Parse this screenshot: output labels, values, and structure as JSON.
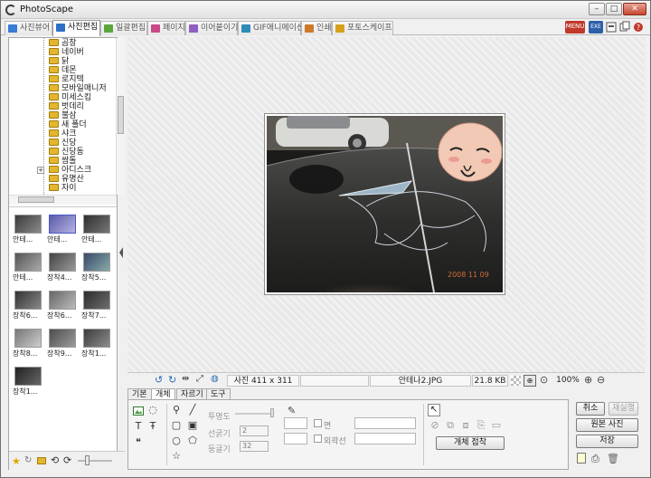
{
  "app": {
    "title": "PhotoScape"
  },
  "tabs": [
    {
      "label": "사진뷰어",
      "color": "#3a7bd5"
    },
    {
      "label": "사진편집",
      "color": "#2e6fc7"
    },
    {
      "label": "일괄편집",
      "color": "#5aa63a"
    },
    {
      "label": "페이지",
      "color": "#c84a8a"
    },
    {
      "label": "이어붙이기",
      "color": "#8e5fc0"
    },
    {
      "label": "GIF애니메이션",
      "color": "#2f8bb8"
    },
    {
      "label": "인쇄",
      "color": "#cc7a2a"
    },
    {
      "label": "포토스케이프",
      "color": "#d6a21c"
    }
  ],
  "top_icons": {
    "menu": "MENU",
    "exe": "EXE"
  },
  "tree": [
    "곰창",
    "네이버",
    "닭",
    "데몬",
    "로지텍",
    "모바일매니저",
    "미세스킴",
    "벗데리",
    "불삼",
    "새 폴더",
    "샤크",
    "신당",
    "신당동",
    "쌈톨",
    "아디스크",
    "유명산",
    "자이"
  ],
  "thumbnails": [
    "안테...",
    "안테...",
    "안테...",
    "안테...",
    "장착4...",
    "장착5...",
    "장착6...",
    "장착6...",
    "장착7...",
    "장착8...",
    "장착9...",
    "장착1...",
    "장착1..."
  ],
  "status": {
    "size": "사진 411 x 311",
    "filename": "안테나2.JPG",
    "filesize": "21.8 KB",
    "zoom": "100%"
  },
  "photo": {
    "date_stamp": "2008 11 09"
  },
  "editor": {
    "subtabs": [
      "기본",
      "개체",
      "자르기",
      "도구"
    ],
    "active_subtab": 1,
    "opacity_label": "투명도",
    "line_width_label": "선굵기",
    "line_width_value": "2",
    "round_label": "둥글기",
    "round_value": "32",
    "face_label": "면",
    "outline_label": "외곽선",
    "object_attach": "개체 접착"
  },
  "actions": {
    "cancel": "취소",
    "redo": "재실행",
    "original": "원본 사진",
    "save": "저장"
  }
}
